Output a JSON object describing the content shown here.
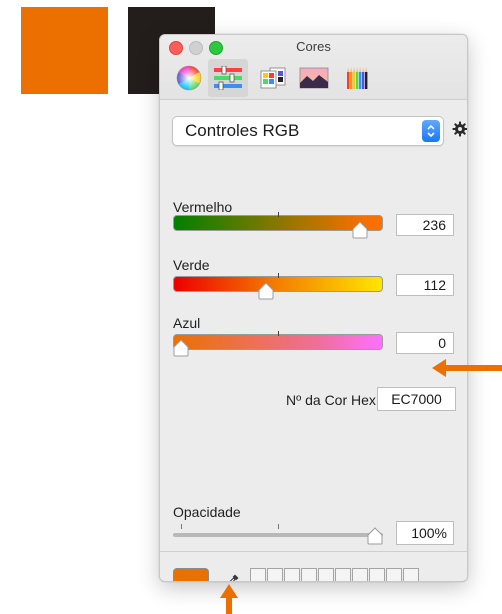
{
  "background_swatches": [
    {
      "name": "orange",
      "color": "#ec7000"
    },
    {
      "name": "dark",
      "color": "#231e1b"
    }
  ],
  "window": {
    "title": "Cores",
    "mode_tabs": [
      {
        "icon": "color-wheel-icon",
        "selected": false
      },
      {
        "icon": "color-sliders-icon",
        "selected": true
      },
      {
        "icon": "color-palettes-icon",
        "selected": false
      },
      {
        "icon": "image-palettes-icon",
        "selected": false
      },
      {
        "icon": "pencils-icon",
        "selected": false
      }
    ]
  },
  "model_popup": {
    "selected": "Controles RGB"
  },
  "sliders": [
    {
      "label": "Vermelho",
      "value": "236",
      "fraction": 0.925
    },
    {
      "label": "Verde",
      "value": "112",
      "fraction": 0.439
    },
    {
      "label": "Azul",
      "value": "0",
      "fraction": 0.0
    }
  ],
  "hex": {
    "label": "Nº da Cor Hex",
    "value": "EC7000"
  },
  "opacity": {
    "label": "Opacidade",
    "value": "100%",
    "fraction": 1.0
  },
  "current_color": "#ec7000",
  "accent_arrow_color": "#ec7000"
}
